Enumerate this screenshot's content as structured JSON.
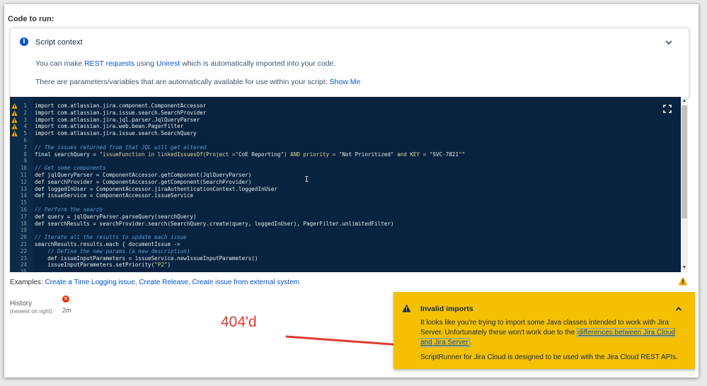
{
  "code_to_run_label": "Code to run:",
  "script_context": {
    "title": "Script context",
    "line1": {
      "prefix": "You can make ",
      "link1": "REST requests",
      "mid": " using ",
      "link2": "Unirest",
      "suffix": " which is automatically imported into your code."
    },
    "line2": {
      "text": "There are parameters/variables that are automatically available for use within your script: ",
      "link": "Show Me"
    }
  },
  "editor": {
    "lines": [
      {
        "n": "1",
        "warn": true,
        "parts": [
          {
            "t": "import",
            "c": "kw"
          },
          {
            "t": " com.atlassian.jira.component.ComponentAccessor",
            "c": ""
          }
        ]
      },
      {
        "n": "2",
        "warn": true,
        "parts": [
          {
            "t": "import",
            "c": "kw"
          },
          {
            "t": " com.atlassian.jira.issue.search.SearchProvider",
            "c": ""
          }
        ]
      },
      {
        "n": "3",
        "warn": true,
        "parts": [
          {
            "t": "import",
            "c": "kw"
          },
          {
            "t": " com.atlassian.jira.jql.parser.JqlQueryParser",
            "c": ""
          }
        ]
      },
      {
        "n": "4",
        "warn": true,
        "parts": [
          {
            "t": "import",
            "c": "kw"
          },
          {
            "t": " com.atlassian.jira.web.bean.PagerFilter",
            "c": ""
          }
        ]
      },
      {
        "n": "5",
        "warn": true,
        "parts": [
          {
            "t": "import",
            "c": "kw"
          },
          {
            "t": " com.atlassian.jira.issue.search.SearchQuery",
            "c": ""
          }
        ]
      },
      {
        "n": "6",
        "warn": false,
        "parts": []
      },
      {
        "n": "7",
        "warn": false,
        "parts": [
          {
            "t": "// The issues returned from that JQL will get altered",
            "c": "cm"
          }
        ]
      },
      {
        "n": "8",
        "warn": false,
        "parts": [
          {
            "t": "final searchQuery = ",
            "c": ""
          },
          {
            "t": "\"issueFunction in linkedIssuesOf(Project =\"",
            "c": "st"
          },
          {
            "t": "CoE Reporting",
            "c": ""
          },
          {
            "t": "\") AND priority = \"",
            "c": "st"
          },
          {
            "t": "Not Prioritized",
            "c": ""
          },
          {
            "t": "\" and KEY = \"",
            "c": "st"
          },
          {
            "t": "SVC-7821",
            "c": ""
          },
          {
            "t": "\"\"",
            "c": "st"
          }
        ]
      },
      {
        "n": "9",
        "warn": false,
        "parts": []
      },
      {
        "n": "10",
        "warn": false,
        "parts": [
          {
            "t": "// Get some components",
            "c": "cm"
          }
        ]
      },
      {
        "n": "11",
        "warn": false,
        "parts": [
          {
            "t": "def jqlQueryParser = ComponentAccessor.getComponent(JqlQueryParser)",
            "c": ""
          }
        ]
      },
      {
        "n": "12",
        "warn": false,
        "parts": [
          {
            "t": "def searchProvider = ComponentAccessor.getComponent(SearchProvider)",
            "c": ""
          }
        ]
      },
      {
        "n": "13",
        "warn": false,
        "parts": [
          {
            "t": "def loggedInUser = ComponentAccessor.jiraAuthenticationContext.loggedInUser",
            "c": ""
          }
        ]
      },
      {
        "n": "14",
        "warn": false,
        "parts": [
          {
            "t": "def issueService = ComponentAccessor.issueService",
            "c": ""
          }
        ]
      },
      {
        "n": "15",
        "warn": false,
        "parts": []
      },
      {
        "n": "16",
        "warn": false,
        "parts": [
          {
            "t": "// Perform the search",
            "c": "cm"
          }
        ]
      },
      {
        "n": "17",
        "warn": false,
        "parts": [
          {
            "t": "def query = jqlQueryParser.parseQuery(searchQuery)",
            "c": ""
          }
        ]
      },
      {
        "n": "18",
        "warn": false,
        "parts": [
          {
            "t": "def searchResults = searchProvider.search(SearchQuery.create(query, loggedInUser), PagerFilter.unlimitedFilter)",
            "c": ""
          }
        ]
      },
      {
        "n": "19",
        "warn": false,
        "parts": []
      },
      {
        "n": "20",
        "warn": false,
        "parts": [
          {
            "t": "// Iterate all the results to update each issue",
            "c": "cm"
          }
        ]
      },
      {
        "n": "21",
        "warn": false,
        "parts": [
          {
            "t": "searchResults.results.each { documentIssue ->",
            "c": ""
          }
        ]
      },
      {
        "n": "22",
        "warn": false,
        "parts": [
          {
            "t": "    // Define the new params (a new description)",
            "c": "cm"
          }
        ]
      },
      {
        "n": "23",
        "warn": false,
        "parts": [
          {
            "t": "    def issueInputParameters = issueService.newIssueInputParameters()",
            "c": ""
          }
        ]
      },
      {
        "n": "24",
        "warn": false,
        "parts": [
          {
            "t": "    issueInputParameters.setPriority(",
            "c": ""
          },
          {
            "t": "\"P2\"",
            "c": "st"
          },
          {
            "t": ")",
            "c": ""
          }
        ]
      },
      {
        "n": "25",
        "warn": false,
        "parts": []
      }
    ]
  },
  "examples": {
    "prefix": "Examples: ",
    "items": [
      "Create a Time Logging issue",
      "Create Release",
      "Create issue from external system"
    ]
  },
  "history": {
    "label": "History",
    "sub": "(newest on right):",
    "time": "2m"
  },
  "annotation": "404'd",
  "flag": {
    "title": "Invalid imports",
    "body_text": "It looks like you're trying to import some Java classes intended to work with Jira Server. Unfortunately these won't work due to the ",
    "body_link": "differences between Jira Cloud and Jira Server",
    "body_end": ".",
    "footer": "ScriptRunner for Jira Cloud is designed to be used with the Jira Cloud REST APIs."
  },
  "colors": {
    "editor_bg": "#08233f",
    "flag_bg": "#f4c000",
    "link": "#0052cc",
    "annotation": "#e03a2f"
  }
}
